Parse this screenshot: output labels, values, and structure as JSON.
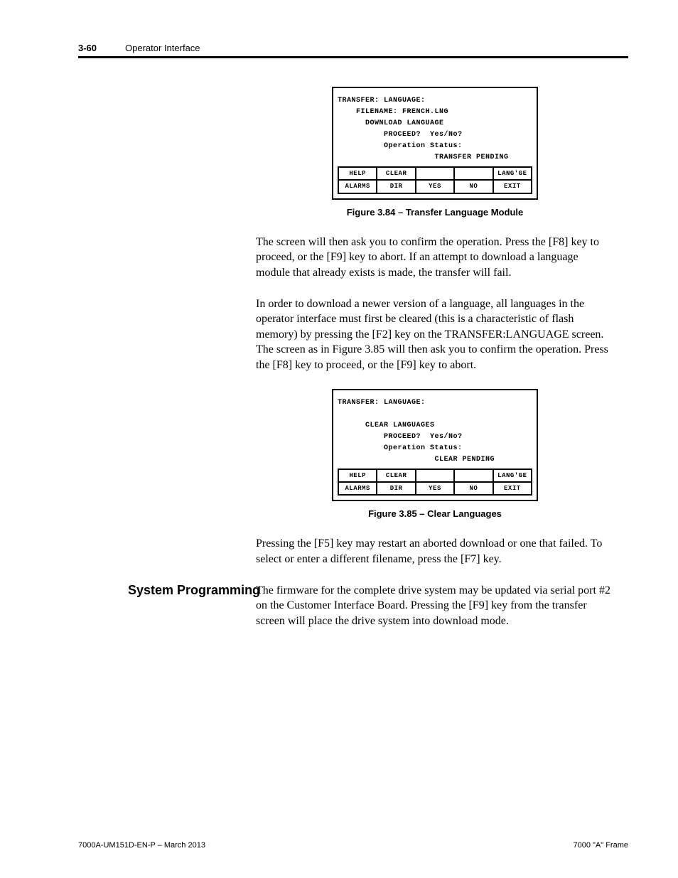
{
  "header": {
    "page_num": "3-60",
    "section": "Operator Interface"
  },
  "fig1": {
    "title": "TRANSFER: LANGUAGE:",
    "l_filename": "    FILENAME: FRENCH.LNG",
    "l_download": "      DOWNLOAD LANGUAGE",
    "l_proceed": "          PROCEED?  Yes/No?",
    "l_opstatus": "          Operation Status:",
    "l_status": "                     TRANSFER PENDING",
    "row1": {
      "c1": "HELP",
      "c2": "CLEAR",
      "c3": "",
      "c4": "",
      "c5": "LANG'GE"
    },
    "row2": {
      "c1": "ALARMS",
      "c2": "DIR",
      "c3": "YES",
      "c4": "NO",
      "c5": "EXIT"
    },
    "caption": "Figure 3.84 – Transfer Language Module"
  },
  "p1": "The screen will then ask you to confirm the operation.  Press the [F8] key to proceed, or the [F9] key to abort.  If an attempt to download a language module that already exists is made, the transfer will fail.",
  "p2": "In order to download a newer version of a language, all languages in the operator interface must first be cleared (this is a characteristic of flash memory) by pressing the [F2] key on the TRANSFER:LANGUAGE screen.  The screen as in Figure 3.85 will then ask you to confirm the operation. Press the [F8] key to proceed, or the [F9] key to abort.",
  "fig2": {
    "title": "TRANSFER: LANGUAGE:",
    "l_clear": "      CLEAR LANGUAGES",
    "l_proceed": "          PROCEED?  Yes/No?",
    "l_opstatus": "          Operation Status:",
    "l_status": "                     CLEAR PENDING",
    "row1": {
      "c1": "HELP",
      "c2": "CLEAR",
      "c3": "",
      "c4": "",
      "c5": "LANG'GE"
    },
    "row2": {
      "c1": "ALARMS",
      "c2": "DIR",
      "c3": "YES",
      "c4": "NO",
      "c5": "EXIT"
    },
    "caption": "Figure 3.85 – Clear Languages"
  },
  "p3": "Pressing the [F5] key may restart an aborted download or one that failed.  To select or enter a different filename, press the [F7] key.",
  "sidebar_heading": "System Programming",
  "p4": "The firmware for the complete drive system may be updated via serial port #2 on the Customer Interface Board.  Pressing the [F9] key from the transfer screen will place the drive system into download mode.",
  "footer": {
    "left": "7000A-UM151D-EN-P – March 2013",
    "right": "7000 \"A\" Frame"
  }
}
